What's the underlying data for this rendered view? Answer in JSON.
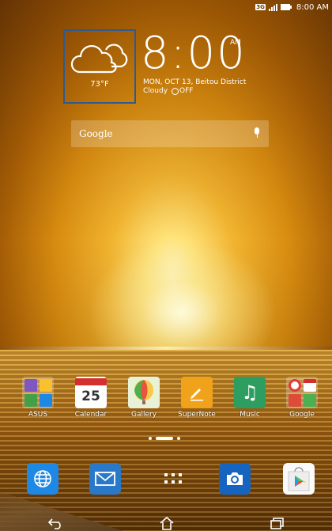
{
  "status_bar": {
    "network_badge": "3G",
    "time": "8:00 AM"
  },
  "weather_widget": {
    "icon": "cloud-icon",
    "temperature": "73°F"
  },
  "clock_widget": {
    "time": "8:00",
    "ampm": "AM",
    "date_location": "MON, OCT 13, Beitou District",
    "condition": "Cloudy",
    "alarm_status": "OFF"
  },
  "search": {
    "label": "Google",
    "mic_icon": "mic-icon"
  },
  "apps": [
    {
      "label": "ASUS",
      "icon": "asus-folder-icon"
    },
    {
      "label": "Calendar",
      "icon": "calendar-icon",
      "date_number": "25"
    },
    {
      "label": "Gallery",
      "icon": "gallery-icon"
    },
    {
      "label": "SuperNote",
      "icon": "supernote-icon"
    },
    {
      "label": "Music",
      "icon": "music-icon"
    },
    {
      "label": "Google",
      "icon": "google-folder-icon"
    }
  ],
  "page_indicator": {
    "pages": 3,
    "current": 2
  },
  "dock": [
    {
      "icon": "browser-icon"
    },
    {
      "icon": "email-icon"
    },
    {
      "icon": "all-apps-icon"
    },
    {
      "icon": "camera-icon"
    },
    {
      "icon": "play-store-icon"
    }
  ],
  "nav": [
    {
      "icon": "back-icon"
    },
    {
      "icon": "home-icon"
    },
    {
      "icon": "recent-apps-icon"
    }
  ],
  "colors": {
    "widget_border": "#2e5a8e",
    "calendar_red": "#d32f2f",
    "music_green": "#2e9d60",
    "supernote_orange": "#f0a21b",
    "dock_blue": "#1e88e5"
  }
}
